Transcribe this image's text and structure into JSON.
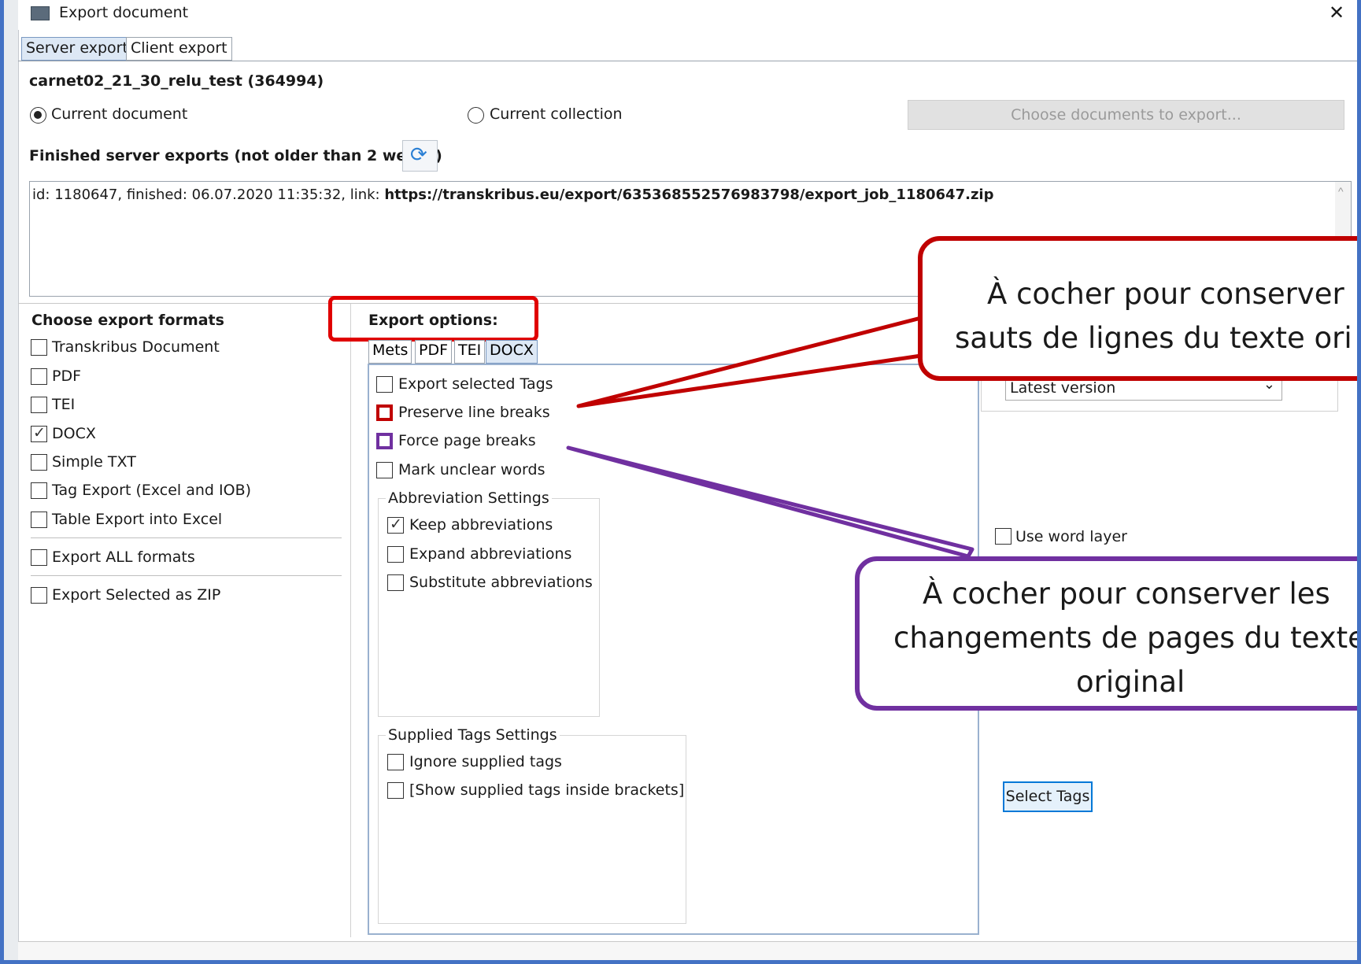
{
  "window": {
    "title": "Export document",
    "close_glyph": "✕"
  },
  "tabs": [
    {
      "label": "Server export",
      "active": true
    },
    {
      "label": "Client export",
      "active": false
    }
  ],
  "document_name": "carnet02_21_30_relu_test (364994)",
  "scope": {
    "current_document": "Current document",
    "current_collection": "Current collection",
    "selected": "Current document",
    "choose_button": "Choose documents to export..."
  },
  "finished_exports": {
    "label": "Finished server exports (not older than 2 weeks)",
    "refresh_icon": "refresh-icon",
    "entry_prefix": "id: 1180647, finished: 06.07.2020 11:35:32, link: ",
    "entry_link": "https://transkribus.eu/export/635368552576983798/export_job_1180647.zip"
  },
  "formats": {
    "title": "Choose export formats",
    "items": [
      {
        "label": "Transkribus Document",
        "checked": false
      },
      {
        "label": "PDF",
        "checked": false
      },
      {
        "label": "TEI",
        "checked": false
      },
      {
        "label": "DOCX",
        "checked": true
      },
      {
        "label": "Simple TXT",
        "checked": false
      },
      {
        "label": "Tag Export (Excel and IOB)",
        "checked": false
      },
      {
        "label": "Table Export into Excel",
        "checked": false
      }
    ],
    "all_label": "Export ALL formats",
    "zip_label": "Export Selected as ZIP"
  },
  "options": {
    "title": "Export options:",
    "subtabs": [
      {
        "label": "Mets",
        "active": false
      },
      {
        "label": "PDF",
        "active": false
      },
      {
        "label": "TEI",
        "active": false
      },
      {
        "label": "DOCX",
        "active": true
      }
    ],
    "checks": [
      {
        "label": "Export selected Tags",
        "checked": false
      },
      {
        "label": "Preserve line breaks",
        "checked": false
      },
      {
        "label": "Force page breaks",
        "checked": false
      },
      {
        "label": "Mark unclear words",
        "checked": false
      }
    ],
    "abbrev_title": "Abbreviation Settings",
    "abbrev": [
      {
        "label": "Keep abbreviations",
        "checked": true
      },
      {
        "label": "Expand abbreviations",
        "checked": false
      },
      {
        "label": "Substitute abbreviations",
        "checked": false
      }
    ],
    "supplied_title": "Supplied Tags Settings",
    "supplied": [
      {
        "label": "Ignore supplied tags",
        "checked": false
      },
      {
        "label": "[Show supplied tags inside brackets]",
        "checked": false
      }
    ]
  },
  "right_panel": {
    "version_value": "Latest version",
    "use_word_layer": "Use word layer",
    "select_tags": "Select Tags"
  },
  "callouts": {
    "red": {
      "line1": "À cocher pour conserver",
      "line2": "sauts de lignes du texte ori",
      "color": "#c00000"
    },
    "purple": {
      "line1": "À cocher pour conserver les",
      "line2": "changements de pages du texte",
      "line3": "original",
      "color": "#7030a0"
    }
  },
  "colors": {
    "frame": "#4472c4",
    "highlight_red": "#e00000",
    "accent": "#0078d7"
  }
}
